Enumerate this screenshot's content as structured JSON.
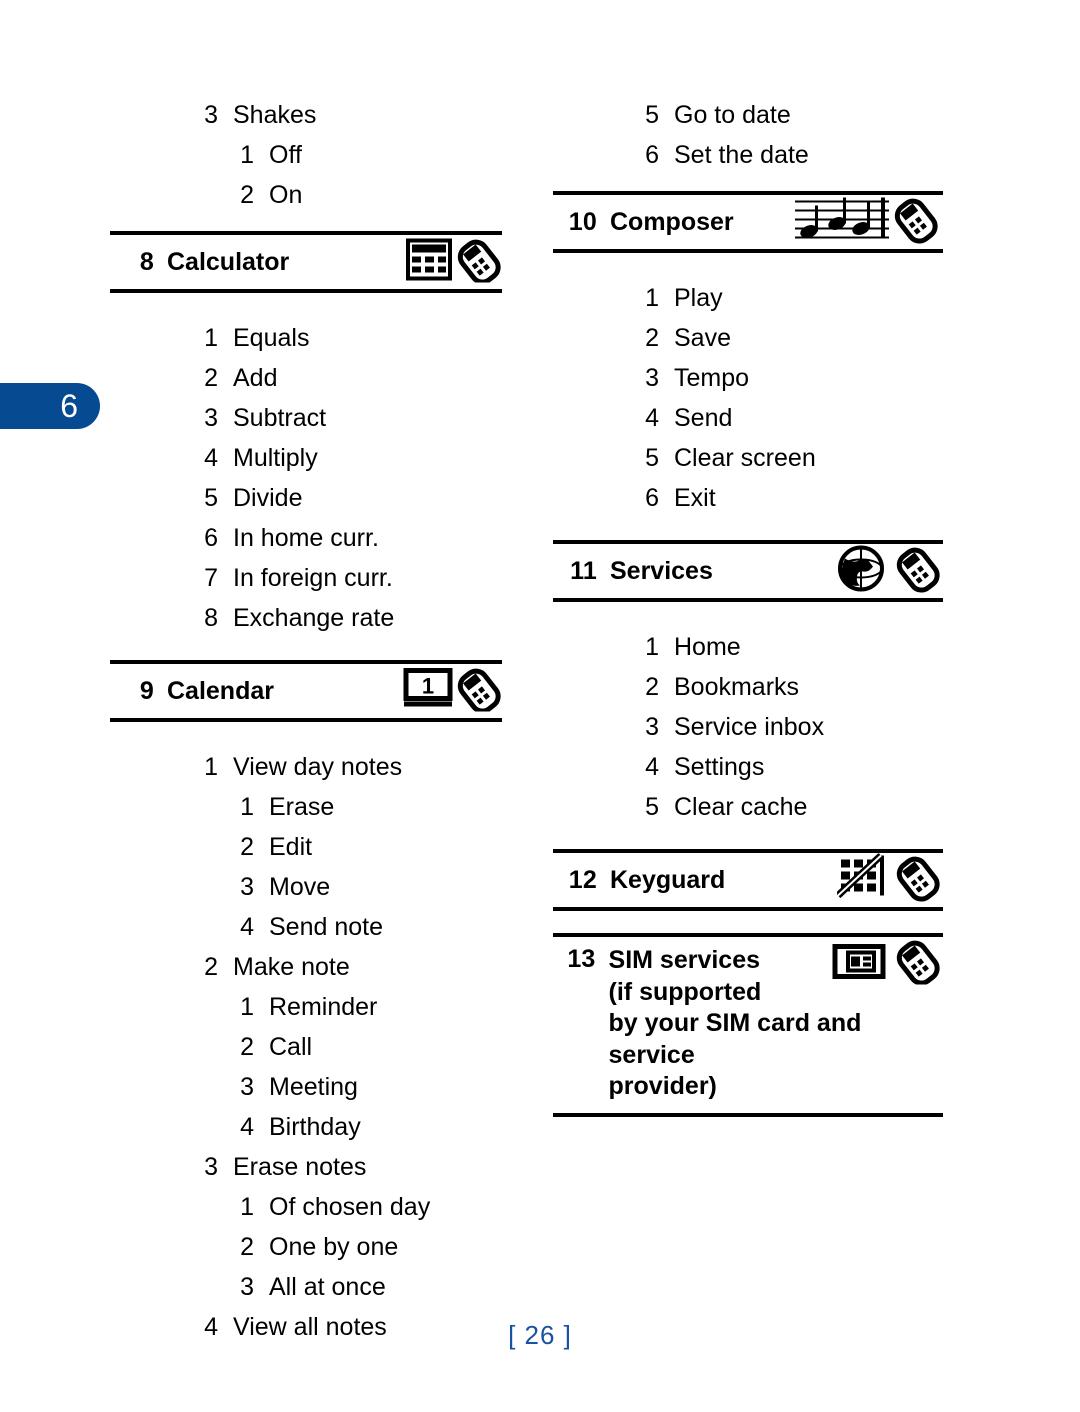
{
  "chapter_tab": {
    "number": "6"
  },
  "page_number": "[ 26 ]",
  "left_column": {
    "pre_items": [
      {
        "num": "3",
        "label": "Shakes",
        "level": 1
      },
      {
        "num": "1",
        "label": "Off",
        "level": 2
      },
      {
        "num": "2",
        "label": "On",
        "level": 2
      }
    ],
    "sections": [
      {
        "num": "8",
        "title": "Calculator",
        "icon": "calculator-phone-icon",
        "items": [
          {
            "num": "1",
            "label": "Equals",
            "level": 1
          },
          {
            "num": "2",
            "label": "Add",
            "level": 1
          },
          {
            "num": "3",
            "label": "Subtract",
            "level": 1
          },
          {
            "num": "4",
            "label": "Multiply",
            "level": 1
          },
          {
            "num": "5",
            "label": "Divide",
            "level": 1
          },
          {
            "num": "6",
            "label": "In home curr.",
            "level": 1
          },
          {
            "num": "7",
            "label": "In foreign curr.",
            "level": 1
          },
          {
            "num": "8",
            "label": "Exchange rate",
            "level": 1
          }
        ]
      },
      {
        "num": "9",
        "title": "Calendar",
        "icon": "calendar-phone-icon",
        "items": [
          {
            "num": "1",
            "label": "View day notes",
            "level": 1
          },
          {
            "num": "1",
            "label": "Erase",
            "level": 2
          },
          {
            "num": "2",
            "label": "Edit",
            "level": 2
          },
          {
            "num": "3",
            "label": "Move",
            "level": 2
          },
          {
            "num": "4",
            "label": "Send note",
            "level": 2
          },
          {
            "num": "2",
            "label": "Make note",
            "level": 1
          },
          {
            "num": "1",
            "label": "Reminder",
            "level": 2
          },
          {
            "num": "2",
            "label": "Call",
            "level": 2
          },
          {
            "num": "3",
            "label": "Meeting",
            "level": 2
          },
          {
            "num": "4",
            "label": "Birthday",
            "level": 2
          },
          {
            "num": "3",
            "label": "Erase notes",
            "level": 1
          },
          {
            "num": "1",
            "label": "Of chosen day",
            "level": 2
          },
          {
            "num": "2",
            "label": "One by one",
            "level": 2
          },
          {
            "num": "3",
            "label": "All at once",
            "level": 2
          },
          {
            "num": "4",
            "label": "View all notes",
            "level": 1
          }
        ]
      }
    ]
  },
  "right_column": {
    "pre_items": [
      {
        "num": "5",
        "label": "Go to date",
        "level": 1
      },
      {
        "num": "6",
        "label": "Set the date",
        "level": 1
      }
    ],
    "sections": [
      {
        "num": "10",
        "title": "Composer",
        "icon": "music-notes-phone-icon",
        "items": [
          {
            "num": "1",
            "label": "Play",
            "level": 1
          },
          {
            "num": "2",
            "label": "Save",
            "level": 1
          },
          {
            "num": "3",
            "label": "Tempo",
            "level": 1
          },
          {
            "num": "4",
            "label": "Send",
            "level": 1
          },
          {
            "num": "5",
            "label": "Clear screen",
            "level": 1
          },
          {
            "num": "6",
            "label": "Exit",
            "level": 1
          }
        ]
      },
      {
        "num": "11",
        "title": "Services",
        "icon": "globe-phone-icon",
        "items": [
          {
            "num": "1",
            "label": "Home",
            "level": 1
          },
          {
            "num": "2",
            "label": "Bookmarks",
            "level": 1
          },
          {
            "num": "3",
            "label": "Service inbox",
            "level": 1
          },
          {
            "num": "4",
            "label": "Settings",
            "level": 1
          },
          {
            "num": "5",
            "label": "Clear cache",
            "level": 1
          }
        ]
      },
      {
        "num": "12",
        "title": "Keyguard",
        "icon": "keypad-disabled-phone-icon",
        "items": []
      },
      {
        "num": "13",
        "title_lines": [
          "SIM services",
          "(if supported",
          "by your SIM card and service",
          "provider)"
        ],
        "icon": "sim-card-phone-icon",
        "items": []
      }
    ]
  }
}
